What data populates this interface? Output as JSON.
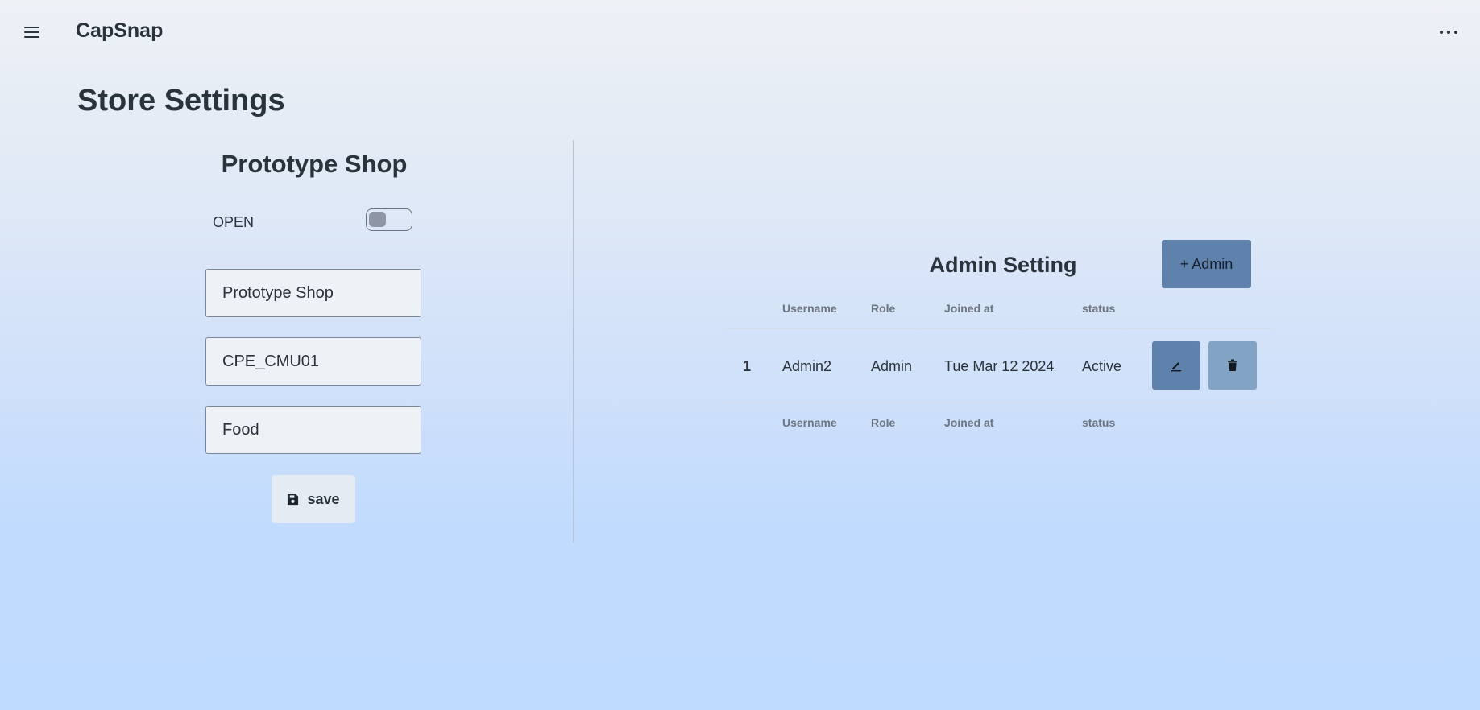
{
  "app": {
    "title": "CapSnap"
  },
  "page": {
    "title": "Store Settings"
  },
  "store": {
    "name": "Prototype Shop",
    "open_label": "OPEN",
    "open": false,
    "fields": [
      {
        "value": "Prototype Shop"
      },
      {
        "value": "CPE_CMU01"
      },
      {
        "value": "Food"
      }
    ],
    "save_label": "save"
  },
  "admin": {
    "title": "Admin Setting",
    "add_button_label": "+ Admin",
    "columns": [
      "Username",
      "Role",
      "Joined at",
      "status"
    ],
    "rows": [
      {
        "index": "1",
        "username": "Admin2",
        "role": "Admin",
        "joined_at": "Tue Mar 12 2024",
        "status": "Active"
      }
    ]
  },
  "icons": {
    "menu": "hamburger-menu-icon",
    "more": "more-horizontal-icon",
    "save": "floppy-disk-icon",
    "edit": "pencil-icon",
    "delete": "trash-icon"
  },
  "colors": {
    "primary_button": "#5f82ad",
    "secondary_button": "#83a3c4",
    "text": "#2a323c"
  }
}
